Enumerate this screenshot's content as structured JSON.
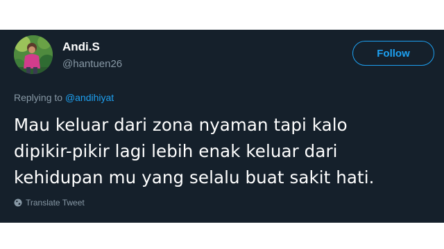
{
  "tweet": {
    "author_name": "Andi.S",
    "author_handle": "@hantuen26",
    "follow_label": "Follow",
    "replying_prefix": "Replying to",
    "replying_to": "@andihiyat",
    "text_lines": [
      "Mau keluar dari zona nyaman tapi kalo",
      "dipikir-pikir lagi lebih enak keluar dari",
      "kehidupan mu yang selalu buat sakit hati."
    ],
    "translate_label": "Translate Tweet"
  },
  "colors": {
    "background": "#15202b",
    "accent": "#1da1f2",
    "secondary_text": "#8899a6",
    "primary_text": "#ffffff"
  },
  "icons": {
    "avatar": "profile-photo",
    "translate": "globe-icon"
  }
}
